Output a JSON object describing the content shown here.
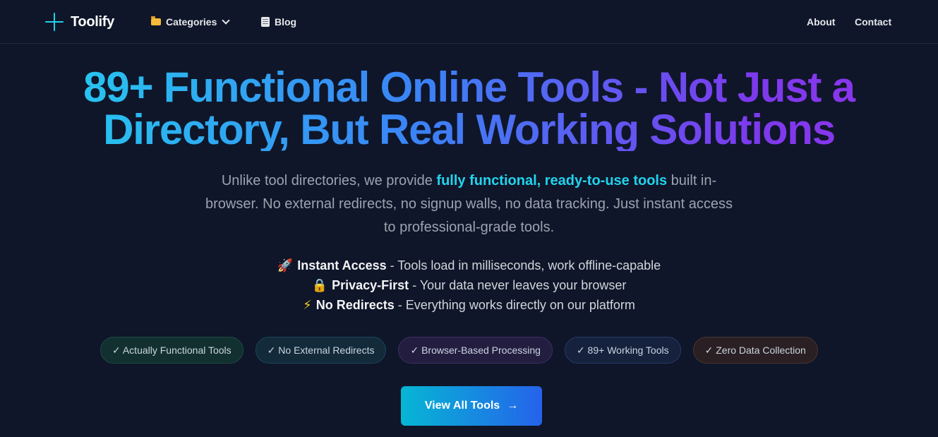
{
  "nav": {
    "brand": "Toolify",
    "categories_label": "Categories",
    "blog_label": "Blog",
    "about_label": "About",
    "contact_label": "Contact",
    "icons": {
      "logo": "plus-cross-icon",
      "categories": "folder-icon",
      "categories_caret": "chevron-down-icon",
      "blog": "document-icon"
    }
  },
  "hero": {
    "title_line1": "89+ Functional Online Tools - Not Just a",
    "title_line2": "Directory, But Real Working Solutions",
    "subtitle_before": "Unlike tool directories, we provide ",
    "subtitle_highlight": "fully functional, ready-to-use tools",
    "subtitle_after": " built in-browser. No external redirects, no signup walls, no data tracking. Just instant access to professional-grade tools.",
    "features": [
      {
        "icon": "🚀",
        "icon_name": "rocket-icon",
        "title": "Instant Access",
        "text": " - Tools load in milliseconds, work offline-capable"
      },
      {
        "icon": "🔒",
        "icon_name": "lock-icon",
        "title": "Privacy-First",
        "text": " - Your data never leaves your browser"
      },
      {
        "icon": "⚡",
        "icon_name": "lightning-icon",
        "title": "No Redirects",
        "text": " - Everything works directly on our platform"
      }
    ],
    "badges": [
      "✓ Actually Functional Tools",
      "✓ No External Redirects",
      "✓ Browser-Based Processing",
      "✓ 89+ Working Tools",
      "✓ Zero Data Collection"
    ],
    "cta_label": "View All Tools",
    "cta_arrow": "→"
  },
  "colors": {
    "background": "#0f1629",
    "accent_cyan": "#22d3ee",
    "accent_blue": "#3b82f6",
    "accent_purple": "#9333ea"
  }
}
